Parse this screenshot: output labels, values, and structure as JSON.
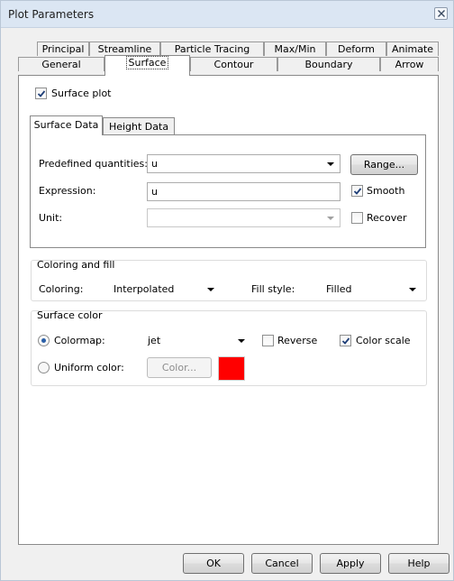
{
  "window": {
    "title": "Plot Parameters"
  },
  "tabs_top_row": [
    "Principal",
    "Streamline",
    "Particle Tracing",
    "Max/Min",
    "Deform",
    "Animate"
  ],
  "tabs_bottom_row": [
    "General",
    "Surface",
    "Contour",
    "Boundary",
    "Arrow"
  ],
  "surface_plot": {
    "label": "Surface plot",
    "checked": true
  },
  "inner_tabs": [
    "Surface Data",
    "Height Data"
  ],
  "surface_data": {
    "predefined_label": "Predefined quantities:",
    "predefined_value": "u",
    "range_button": "Range...",
    "expression_label": "Expression:",
    "expression_value": "u",
    "smooth_label": "Smooth",
    "smooth_checked": true,
    "unit_label": "Unit:",
    "unit_value": "",
    "recover_label": "Recover",
    "recover_checked": false
  },
  "coloring_fill": {
    "group_title": "Coloring and fill",
    "coloring_label": "Coloring:",
    "coloring_value": "Interpolated",
    "fill_style_label": "Fill style:",
    "fill_style_value": "Filled"
  },
  "surface_color": {
    "group_title": "Surface color",
    "colormap_label": "Colormap:",
    "colormap_value": "jet",
    "colormap_selected": true,
    "reverse_label": "Reverse",
    "reverse_checked": false,
    "color_scale_label": "Color scale",
    "color_scale_checked": true,
    "uniform_label": "Uniform color:",
    "color_button": "Color...",
    "swatch_color": "#ff0000"
  },
  "buttons": {
    "ok": "OK",
    "cancel": "Cancel",
    "apply": "Apply",
    "help": "Help"
  }
}
